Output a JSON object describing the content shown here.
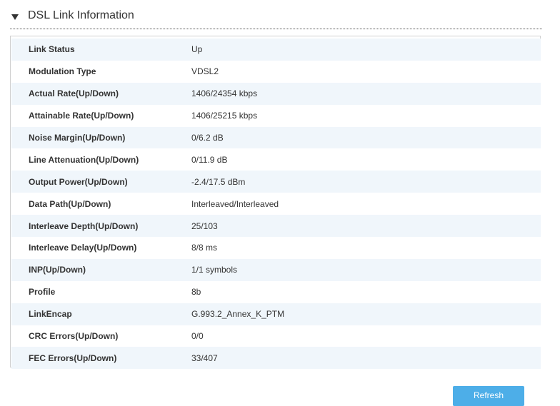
{
  "section": {
    "title": "DSL Link Information",
    "toggle_icon": "caret-down-icon"
  },
  "rows": [
    {
      "label": "Link Status",
      "value": "Up"
    },
    {
      "label": "Modulation Type",
      "value": "VDSL2"
    },
    {
      "label": "Actual Rate(Up/Down)",
      "value": "1406/24354 kbps"
    },
    {
      "label": "Attainable Rate(Up/Down)",
      "value": "1406/25215 kbps"
    },
    {
      "label": "Noise Margin(Up/Down)",
      "value": "0/6.2 dB"
    },
    {
      "label": "Line Attenuation(Up/Down)",
      "value": "0/11.9 dB"
    },
    {
      "label": "Output Power(Up/Down)",
      "value": "-2.4/17.5 dBm"
    },
    {
      "label": "Data Path(Up/Down)",
      "value": "Interleaved/Interleaved"
    },
    {
      "label": "Interleave Depth(Up/Down)",
      "value": "25/103"
    },
    {
      "label": "Interleave Delay(Up/Down)",
      "value": "8/8 ms"
    },
    {
      "label": "INP(Up/Down)",
      "value": "1/1 symbols"
    },
    {
      "label": "Profile",
      "value": "8b"
    },
    {
      "label": "LinkEncap",
      "value": "G.993.2_Annex_K_PTM"
    },
    {
      "label": "CRC Errors(Up/Down)",
      "value": "0/0"
    },
    {
      "label": "FEC Errors(Up/Down)",
      "value": "33/407"
    }
  ],
  "actions": {
    "refresh_label": "Refresh"
  },
  "colors": {
    "accent": "#4daee8",
    "row_alt": "#f0f6fb",
    "border": "#d0d0d0"
  }
}
